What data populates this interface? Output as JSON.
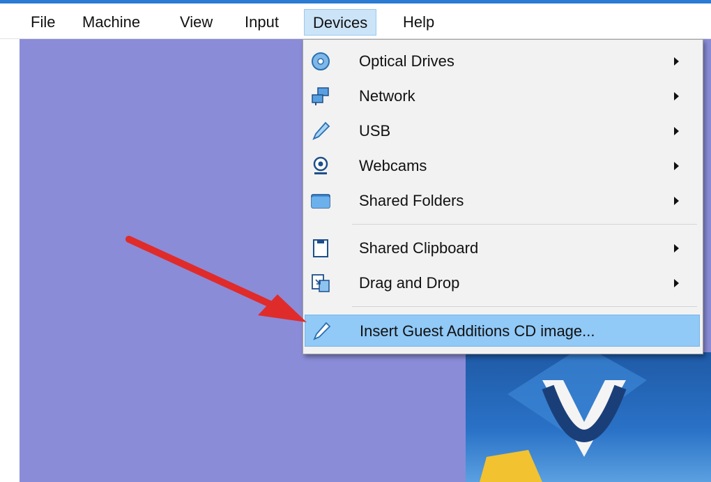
{
  "menubar": {
    "items": [
      {
        "label": "File"
      },
      {
        "label": "Machine"
      },
      {
        "label": "View"
      },
      {
        "label": "Input"
      },
      {
        "label": "Devices"
      },
      {
        "label": "Help"
      }
    ]
  },
  "devices_menu": {
    "items": [
      {
        "label": "Optical Drives",
        "icon": "optical-disc-icon"
      },
      {
        "label": "Network",
        "icon": "network-icon"
      },
      {
        "label": "USB",
        "icon": "usb-icon"
      },
      {
        "label": "Webcams",
        "icon": "webcam-icon"
      },
      {
        "label": "Shared Folders",
        "icon": "folder-icon"
      },
      {
        "label": "Shared Clipboard",
        "icon": "clipboard-icon"
      },
      {
        "label": "Drag and Drop",
        "icon": "drag-drop-icon"
      },
      {
        "label": "Insert Guest Additions CD image...",
        "icon": "guest-additions-icon"
      }
    ]
  },
  "colors": {
    "desktop": "#8a8cd8",
    "menu_bg": "#f2f2f2",
    "highlight": "#91c9f7",
    "arrow": "#e02b2b",
    "accent": "#2b7bd3"
  }
}
